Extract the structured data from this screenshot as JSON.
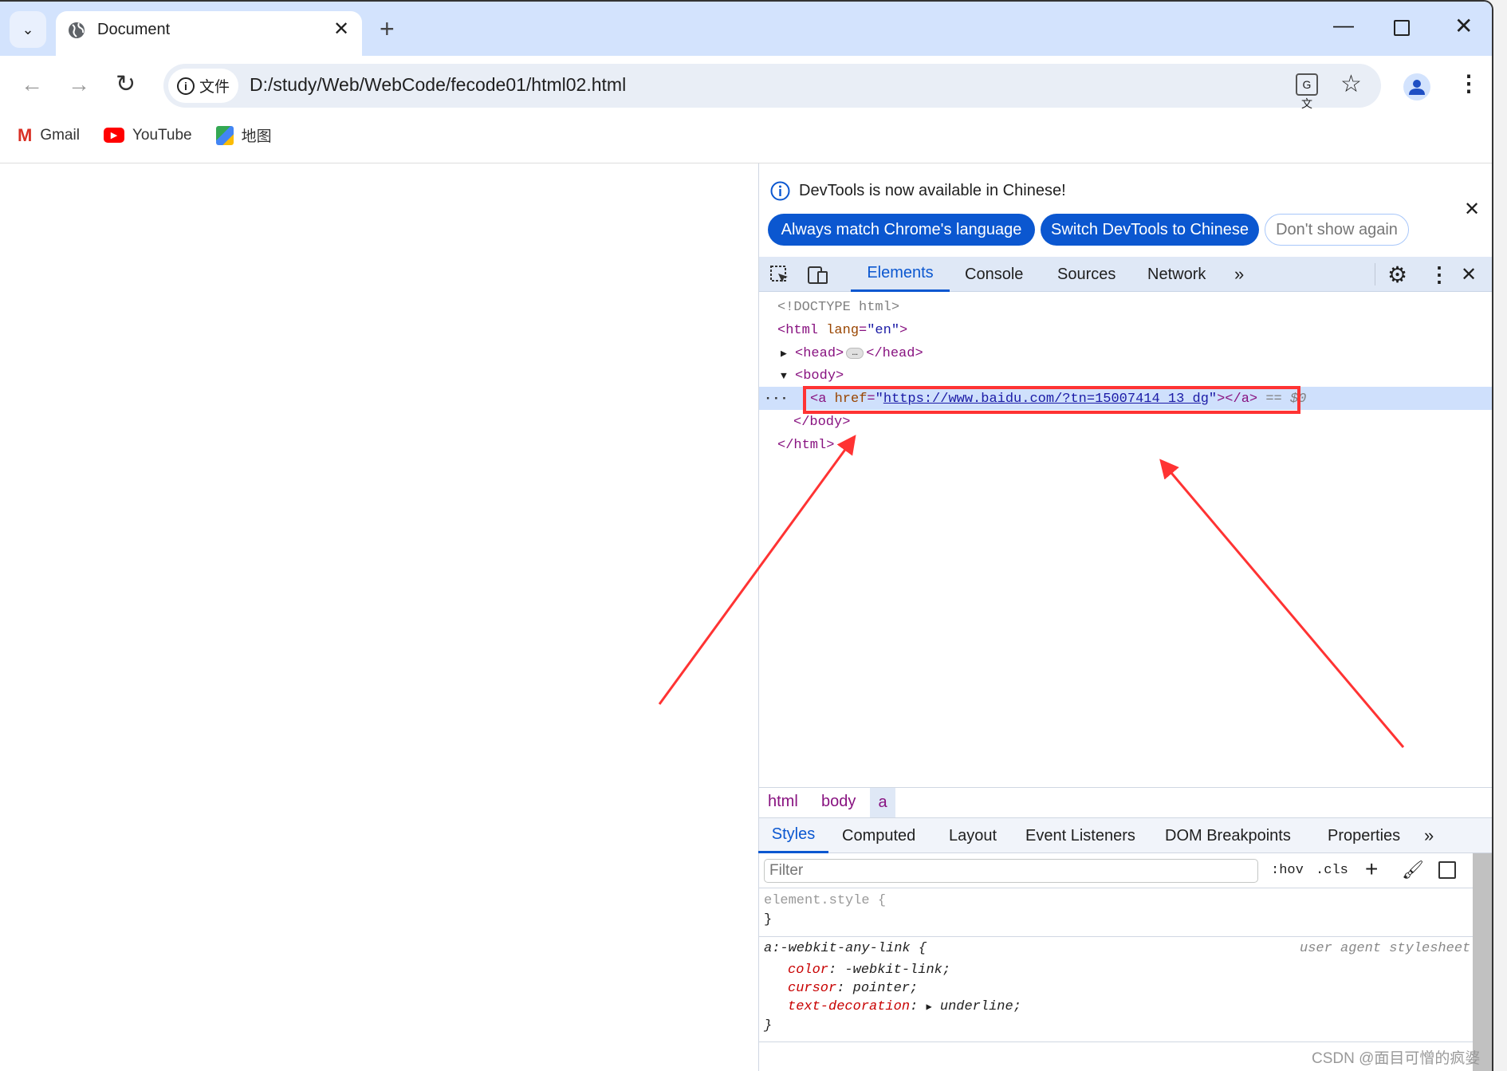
{
  "browser": {
    "tab_title": "Document",
    "url": "D:/study/Web/WebCode/fecode01/html02.html",
    "url_chip": "文件",
    "bookmarks": [
      {
        "label": "Gmail",
        "icon": "gmail-icon"
      },
      {
        "label": "YouTube",
        "icon": "youtube-icon"
      },
      {
        "label": "地图",
        "icon": "maps-icon"
      }
    ]
  },
  "devtools": {
    "banner": {
      "text": "DevTools is now available in Chinese!",
      "buttons": [
        "Always match Chrome's language",
        "Switch DevTools to Chinese",
        "Don't show again"
      ]
    },
    "tabs": [
      "Elements",
      "Console",
      "Sources",
      "Network"
    ],
    "active_tab": "Elements",
    "dom": {
      "doctype": "<!DOCTYPE html>",
      "html_open": "<html",
      "lang_attr": "lang",
      "lang_val": "\"en\"",
      "gt": ">",
      "head_open": "<head>",
      "head_close": "</head>",
      "body_open": "<body>",
      "a_open": "<a",
      "href_attr": "href",
      "eq": "=",
      "quote": "\"",
      "href_val": "https://www.baidu.com/?tn=15007414_13_dg",
      "a_close": "></a>",
      "selected_marker": "== $0",
      "body_close": "</body>",
      "html_close": "</html>",
      "ellipsis": "…"
    },
    "breadcrumb": [
      "html",
      "body",
      "a"
    ],
    "styles_tabs": [
      "Styles",
      "Computed",
      "Layout",
      "Event Listeners",
      "DOM Breakpoints",
      "Properties"
    ],
    "filter_placeholder": "Filter",
    "hov": ":hov",
    "cls": ".cls",
    "rules": {
      "element_style": "element.style {",
      "close": "}",
      "selector": "a:-webkit-any-link {",
      "source": "user agent stylesheet",
      "props": [
        {
          "name": "color",
          "value": "-webkit-link;"
        },
        {
          "name": "cursor",
          "value": "pointer;"
        },
        {
          "name": "text-decoration",
          "value": "underline;"
        }
      ]
    }
  },
  "watermark": "CSDN @面目可憎的疯婆子",
  "colors": {
    "accent": "#0b57d0",
    "annotation": "#ff3333",
    "selected_row": "#cfe0fc"
  }
}
